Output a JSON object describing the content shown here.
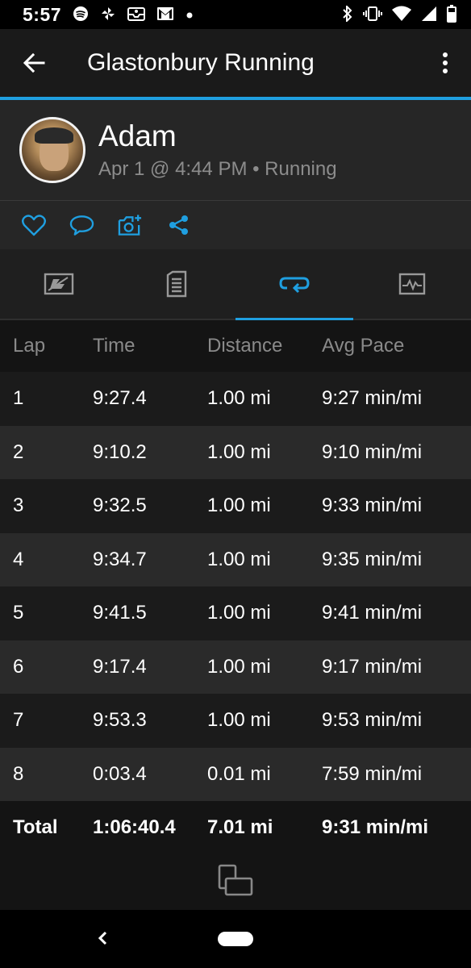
{
  "status_bar": {
    "time": "5:57",
    "left_icons": [
      "spotify-icon",
      "pinwheel-icon",
      "inbox-icon",
      "gmail-icon",
      "dot-icon"
    ],
    "right_icons": [
      "bluetooth-icon",
      "vibrate-icon",
      "wifi-icon",
      "signal-icon",
      "battery-icon"
    ]
  },
  "app_bar": {
    "title": "Glastonbury Running"
  },
  "profile": {
    "name": "Adam",
    "meta": "Apr 1 @ 4:44 PM • Running"
  },
  "actions": [
    "heart-icon",
    "comment-icon",
    "add-photo-icon",
    "share-icon"
  ],
  "tabs": [
    {
      "id": "map",
      "icon": "map-icon",
      "active": false
    },
    {
      "id": "details",
      "icon": "document-icon",
      "active": false
    },
    {
      "id": "laps",
      "icon": "laps-icon",
      "active": true
    },
    {
      "id": "charts",
      "icon": "chart-icon",
      "active": false
    }
  ],
  "laps_table": {
    "headers": [
      "Lap",
      "Time",
      "Distance",
      "Avg Pace"
    ],
    "rows": [
      [
        "1",
        "9:27.4",
        "1.00 mi",
        "9:27 min/mi"
      ],
      [
        "2",
        "9:10.2",
        "1.00 mi",
        "9:10 min/mi"
      ],
      [
        "3",
        "9:32.5",
        "1.00 mi",
        "9:33 min/mi"
      ],
      [
        "4",
        "9:34.7",
        "1.00 mi",
        "9:35 min/mi"
      ],
      [
        "5",
        "9:41.5",
        "1.00 mi",
        "9:41 min/mi"
      ],
      [
        "6",
        "9:17.4",
        "1.00 mi",
        "9:17 min/mi"
      ],
      [
        "7",
        "9:53.3",
        "1.00 mi",
        "9:53 min/mi"
      ],
      [
        "8",
        "0:03.4",
        "0.01 mi",
        "7:59 min/mi"
      ]
    ],
    "total": [
      "Total",
      "1:06:40.4",
      "7.01 mi",
      "9:31 min/mi"
    ]
  },
  "colors": {
    "accent": "#1f9fe0"
  }
}
